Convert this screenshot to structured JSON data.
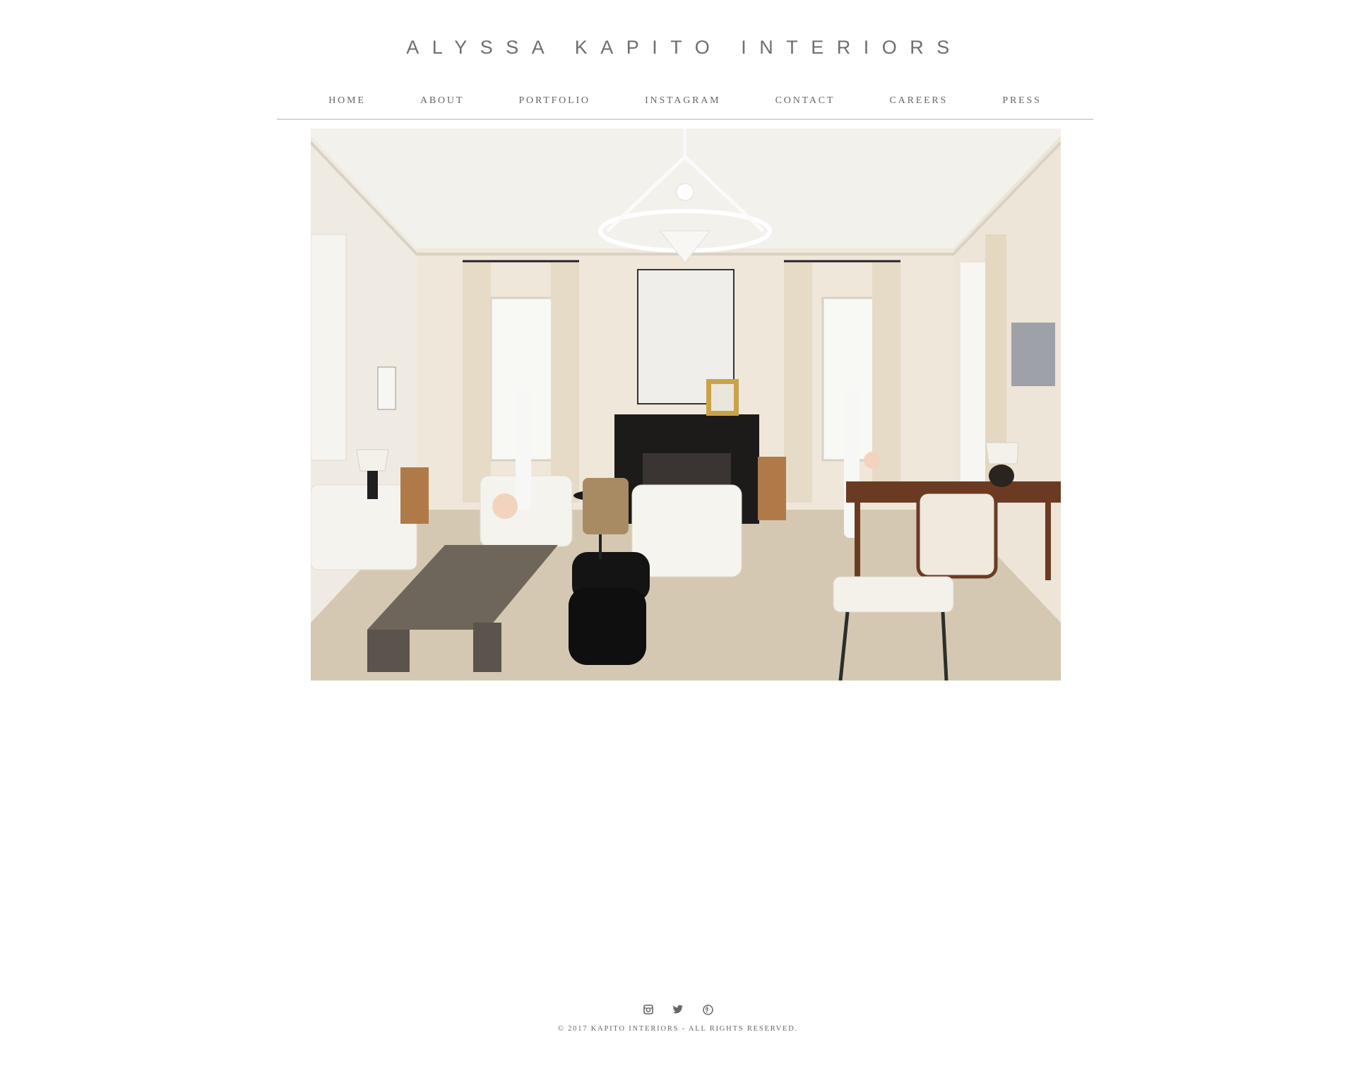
{
  "site": {
    "title": "ALYSSA KAPITO INTERIORS"
  },
  "nav": {
    "items": [
      {
        "label": "HOME"
      },
      {
        "label": "ABOUT"
      },
      {
        "label": "PORTFOLIO"
      },
      {
        "label": "INSTAGRAM"
      },
      {
        "label": "CONTACT"
      },
      {
        "label": "CAREERS"
      },
      {
        "label": "PRESS"
      }
    ]
  },
  "hero": {
    "image_alt": "Living room interior"
  },
  "footer": {
    "icons": [
      "instagram-icon",
      "twitter-icon",
      "pinterest-icon"
    ],
    "copyright": "© 2017 KAPITO INTERIORS - ALL RIGHTS RESERVED."
  },
  "colors": {
    "text": "#666666",
    "rule": "#d6d6d6",
    "background": "#ffffff"
  }
}
